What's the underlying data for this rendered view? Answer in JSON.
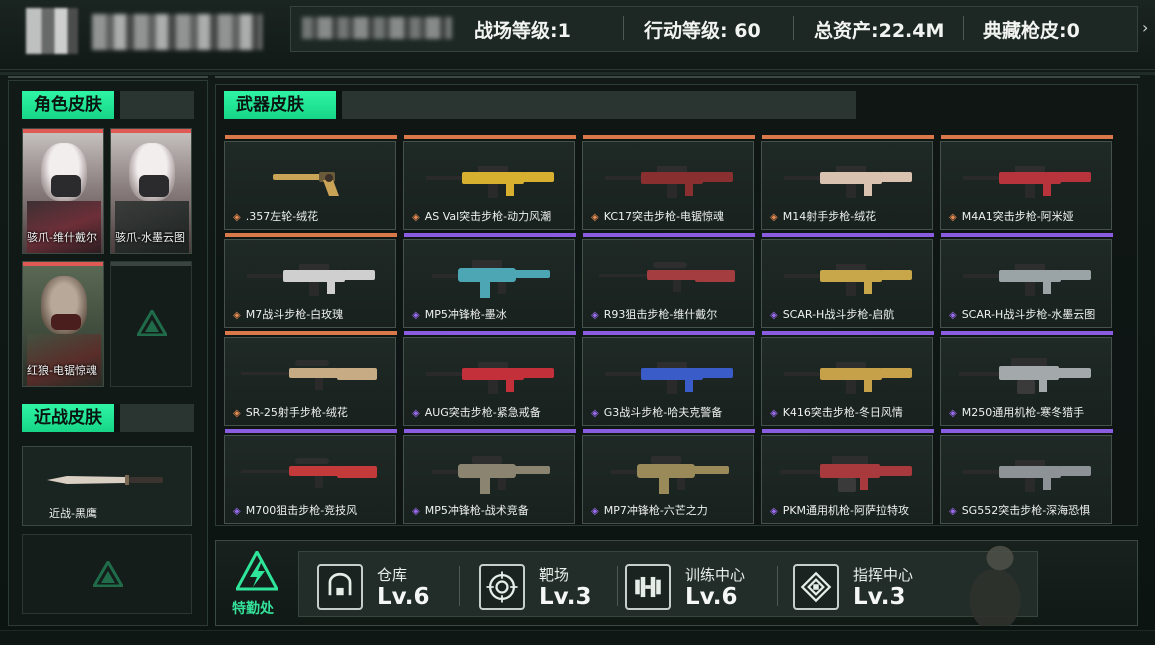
{
  "header": {
    "stats": [
      {
        "label": "战场等级:",
        "value": "1"
      },
      {
        "label": "行动等级: ",
        "value": "60"
      },
      {
        "label": "总资产:",
        "value": "22.4M"
      },
      {
        "label": "典藏枪皮:",
        "value": "0"
      }
    ],
    "arrow": "›"
  },
  "character_skins": {
    "title": "角色皮肤",
    "items": [
      {
        "label": "骇爪-维什戴尔",
        "style": "pink"
      },
      {
        "label": "骇爪-水墨云图",
        "style": "pink"
      },
      {
        "label": "红狼-电锯惊魂",
        "style": "green"
      },
      {
        "label": "",
        "style": "empty"
      }
    ]
  },
  "melee_skins": {
    "title": "近战皮肤",
    "items": [
      {
        "label": "近战-黑鹰"
      }
    ]
  },
  "weapon_skins": {
    "title": "武器皮肤",
    "items": [
      {
        "label": ".357左轮-绒花",
        "rarity": "orange",
        "kind": "pistol",
        "color": "#c9a356"
      },
      {
        "label": "AS Val突击步枪-动力风潮",
        "rarity": "orange",
        "kind": "rifle",
        "color": "#d8b030"
      },
      {
        "label": "KC17突击步枪-电锯惊魂",
        "rarity": "orange",
        "kind": "rifle",
        "color": "#8a2f2f"
      },
      {
        "label": "M14射手步枪-绒花",
        "rarity": "orange",
        "kind": "rifle",
        "color": "#d9c3b0"
      },
      {
        "label": "M4A1突击步枪-阿米娅",
        "rarity": "orange",
        "kind": "rifle",
        "color": "#b8343c"
      },
      {
        "label": "M7战斗步枪-白玫瑰",
        "rarity": "orange",
        "kind": "rifle",
        "color": "#d0cfcf"
      },
      {
        "label": "MP5冲锋枪-墨冰",
        "rarity": "purple",
        "kind": "smg",
        "color": "#4da6b3"
      },
      {
        "label": "R93狙击步枪-维什戴尔",
        "rarity": "purple",
        "kind": "sniper",
        "color": "#a33d40"
      },
      {
        "label": "SCAR-H战斗步枪-启航",
        "rarity": "purple",
        "kind": "rifle",
        "color": "#c8a64a"
      },
      {
        "label": "SCAR-H战斗步枪-水墨云图",
        "rarity": "purple",
        "kind": "rifle",
        "color": "#9aa3a6"
      },
      {
        "label": "SR-25射手步枪-绒花",
        "rarity": "orange",
        "kind": "sniper",
        "color": "#c7ab85"
      },
      {
        "label": "AUG突击步枪-紧急戒备",
        "rarity": "purple",
        "kind": "rifle",
        "color": "#c4303a"
      },
      {
        "label": "G3战斗步枪-哈夫克警备",
        "rarity": "purple",
        "kind": "rifle",
        "color": "#3a5cc8"
      },
      {
        "label": "K416突击步枪-冬日风情",
        "rarity": "purple",
        "kind": "rifle",
        "color": "#c7a04a"
      },
      {
        "label": "M250通用机枪-寒冬猎手",
        "rarity": "purple",
        "kind": "lmg",
        "color": "#a3a8ab"
      },
      {
        "label": "M700狙击步枪-竞技风",
        "rarity": "purple",
        "kind": "sniper",
        "color": "#c33a3a"
      },
      {
        "label": "MP5冲锋枪-战术竞备",
        "rarity": "purple",
        "kind": "smg",
        "color": "#8a8470"
      },
      {
        "label": "MP7冲锋枪-六芒之力",
        "rarity": "purple",
        "kind": "smg",
        "color": "#9a8a5a"
      },
      {
        "label": "PKM通用机枪-阿萨拉特攻",
        "rarity": "purple",
        "kind": "lmg",
        "color": "#a83a3e"
      },
      {
        "label": "SG552突击步枪-深海恐惧",
        "rarity": "purple",
        "kind": "rifle",
        "color": "#8d9296"
      }
    ]
  },
  "bottom": {
    "logo_label": "特勤处",
    "facilities": [
      {
        "name": "仓库",
        "level": "Lv.6",
        "icon": "warehouse-icon"
      },
      {
        "name": "靶场",
        "level": "Lv.3",
        "icon": "target-icon"
      },
      {
        "name": "训练中心",
        "level": "Lv.6",
        "icon": "dumbbell-icon"
      },
      {
        "name": "指挥中心",
        "level": "Lv.3",
        "icon": "command-icon"
      }
    ]
  },
  "colors": {
    "accent": "#2ef5a5",
    "orange_rarity": "#d9794a",
    "purple_rarity": "#8a5ce0"
  }
}
